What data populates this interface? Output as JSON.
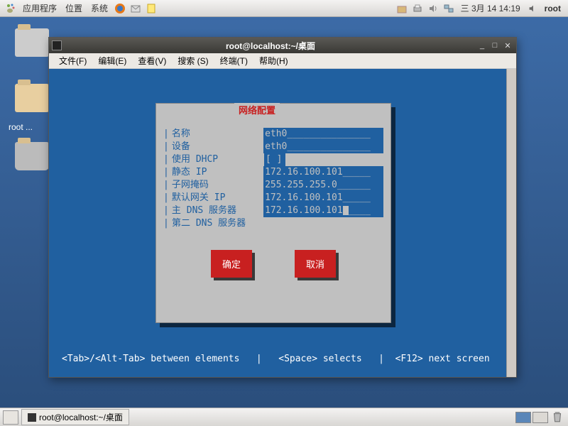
{
  "top_panel": {
    "apps": "应用程序",
    "places": "位置",
    "system": "系统",
    "datetime": "三 3月 14 14:19",
    "user": "root"
  },
  "desktop": {
    "home_label": "root ..."
  },
  "window": {
    "title": "root@localhost:~/桌面",
    "menu": {
      "file": "文件(F)",
      "edit": "编辑(E)",
      "view": "查看(V)",
      "search": "搜索 (S)",
      "terminal": "终端(T)",
      "help": "帮助(H)"
    }
  },
  "dialog": {
    "title": "网络配置",
    "fields": {
      "name_lbl": "名称",
      "name_val": "eth0_______________",
      "device_lbl": "设备",
      "device_val": "eth0_______________",
      "dhcp_lbl": "使用 DHCP",
      "dhcp_val": "[ ]",
      "static_lbl": "静态 IP",
      "static_val": "172.16.100.101_____",
      "mask_lbl": "子网掩码",
      "mask_val": "255.255.255.0______",
      "gw_lbl": "默认网关 IP",
      "gw_val": "172.16.100.101_____",
      "dns1_lbl": "主 DNS 服务器",
      "dns1_val": "172.16.100.101",
      "dns1_after": "____",
      "dns2_lbl": "第二 DNS 服务器",
      "dns2_val": ""
    },
    "ok": "确定",
    "cancel": "取消"
  },
  "hints": "<Tab>/<Alt-Tab> between elements   |   <Space> selects   |  <F12> next screen",
  "taskbar": {
    "task1": "root@localhost:~/桌面"
  }
}
